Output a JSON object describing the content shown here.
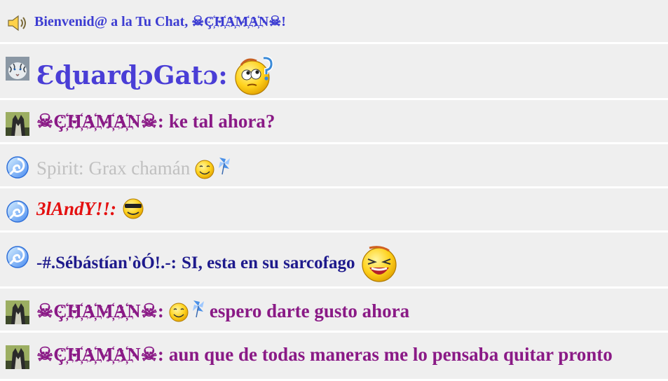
{
  "colors": {
    "welcome": "#3c3cd2",
    "eduardo": "#4a3ed6",
    "chaman": "#8a1a86",
    "spirit": "#c0c0c0",
    "andy": "#e41010",
    "sebastian": "#1e1a8c"
  },
  "welcome": {
    "icon": "speaker-icon",
    "text": "Bienvenid@ a la Tu Chat, ☠Ç҉H҉A҉M҉A҉N☠!"
  },
  "messages": [
    {
      "avatar": "white-tiger-avatar",
      "name": "ƐɖuarɖɔGatɔ:",
      "text": "",
      "emoticon": "thinking-face-emoticon"
    },
    {
      "avatar": "wolf-avatar",
      "name": "☠Ç҉H҉A҉M҉A҉N☠:",
      "text": "ke tal ahora?",
      "emoticon": ""
    },
    {
      "avatar": "swirl-avatar",
      "name": "Spirit:",
      "text": "Grax chamán",
      "emoticon": "smile-pinwheel-emoticon"
    },
    {
      "avatar": "swirl-avatar",
      "name": "3lAndY!!:",
      "text": "",
      "emoticon": "sunglasses-emoticon"
    },
    {
      "avatar": "swirl-avatar",
      "name": "-#.Sébástían'òÓ!.-:",
      "text": "SI, esta en su sarcofago",
      "emoticon": "laughing-emoticon"
    },
    {
      "avatar": "wolf-avatar",
      "name": "☠Ç҉H҉A҉M҉A҉N☠:",
      "text": "espero darte gusto ahora",
      "emoticon": "smile-pinwheel-emoticon"
    },
    {
      "avatar": "wolf-avatar",
      "name": "☠Ç҉H҉A҉M҉A҉N☠:",
      "text": "aun que de todas maneras me lo pensaba quitar pronto",
      "emoticon": ""
    }
  ]
}
